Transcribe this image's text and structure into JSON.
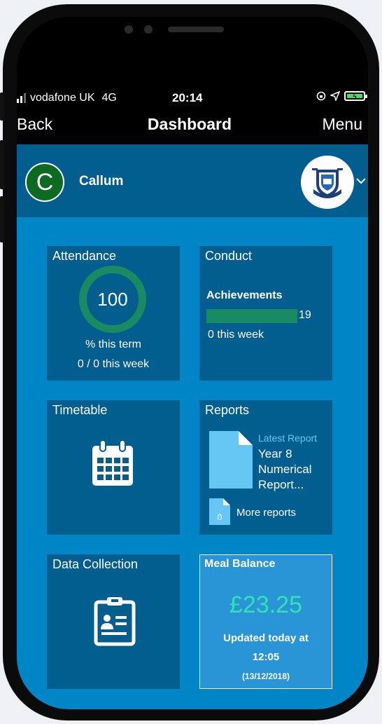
{
  "status_bar": {
    "carrier": "vodafone UK",
    "network": "4G",
    "time": "20:14"
  },
  "nav": {
    "back": "Back",
    "title": "Dashboard",
    "menu": "Menu"
  },
  "profile": {
    "initial": "C",
    "name": "Callum"
  },
  "tiles": {
    "attendance": {
      "title": "Attendance",
      "value": "100",
      "line1": "% this term",
      "line2": "0 / 0 this week"
    },
    "conduct": {
      "title": "Conduct",
      "achievements_label": "Achievements",
      "achievements_count": "19",
      "week": "0 this week"
    },
    "timetable": {
      "title": "Timetable"
    },
    "reports": {
      "title": "Reports",
      "latest_label": "Latest Report",
      "latest_name": "Year 8 Numerical Report...",
      "more_count": "0",
      "more_label": "More reports"
    },
    "data_collection": {
      "title": "Data Collection"
    },
    "meal_balance": {
      "title": "Meal Balance",
      "amount": "£23.25",
      "updated_line1": "Updated today at",
      "updated_line2": "12:05",
      "date": "(13/12/2018)"
    }
  },
  "colors": {
    "background": "#0086c6",
    "tile": "#025e8e",
    "accent_green": "#1a8a63",
    "meal_tile": "#2a95d6",
    "meal_amount": "#2fe3b4"
  },
  "icons": [
    "signal-icon",
    "location-icon",
    "battery-icon",
    "school-crest-icon",
    "chevron-down-icon",
    "calendar-icon",
    "clipboard-icon",
    "document-icon"
  ]
}
